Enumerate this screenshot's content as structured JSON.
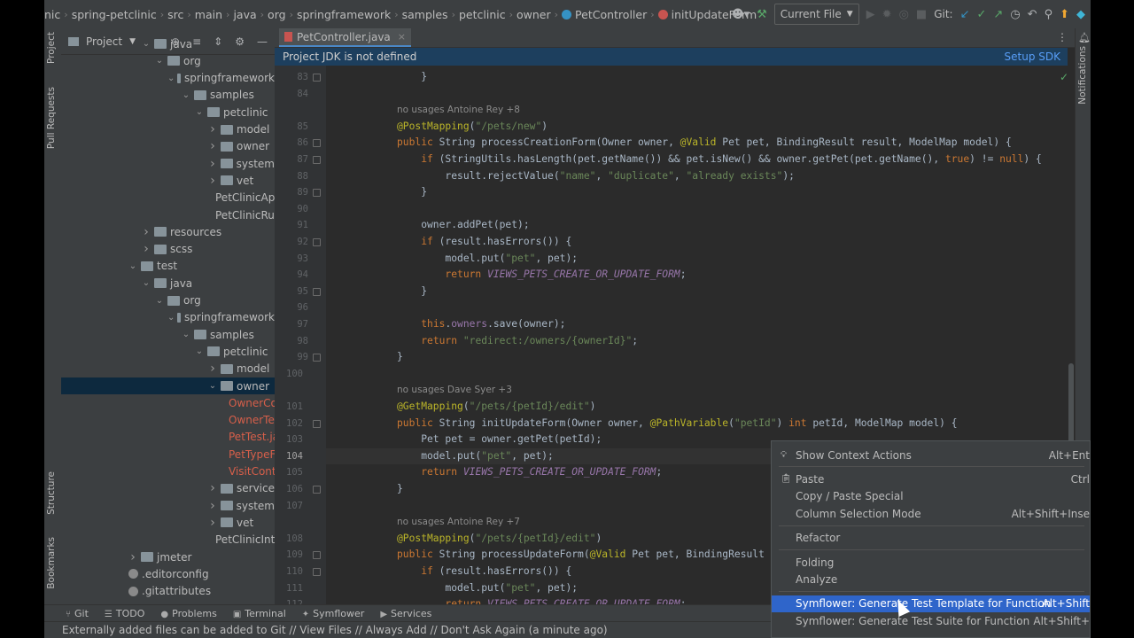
{
  "navbar": {
    "crumbs": [
      "nic",
      "spring-petclinic",
      "src",
      "main",
      "java",
      "org",
      "springframework",
      "samples",
      "petclinic",
      "owner"
    ],
    "class_crumb": "PetController",
    "method_crumb": "initUpdateForm",
    "run_config": "Current File",
    "git_label": "Git:"
  },
  "left_strip": {
    "project": "Project",
    "pull_requests": "Pull Requests",
    "structure": "Structure",
    "bookmarks": "Bookmarks"
  },
  "right_strip": {
    "notifications": "Notifications"
  },
  "project": {
    "header": "Project",
    "rows": [
      {
        "label": "java",
        "indent": 0,
        "kind": "folder",
        "arrow": "down"
      },
      {
        "label": "org",
        "indent": 1,
        "kind": "folder",
        "arrow": "down"
      },
      {
        "label": "springframework",
        "indent": 2,
        "kind": "folder",
        "arrow": "down"
      },
      {
        "label": "samples",
        "indent": 3,
        "kind": "folder",
        "arrow": "down"
      },
      {
        "label": "petclinic",
        "indent": 4,
        "kind": "folder",
        "arrow": "down"
      },
      {
        "label": "model",
        "indent": 5,
        "kind": "folder",
        "arrow": "right"
      },
      {
        "label": "owner",
        "indent": 5,
        "kind": "folder",
        "arrow": "right"
      },
      {
        "label": "system",
        "indent": 5,
        "kind": "folder",
        "arrow": "right"
      },
      {
        "label": "vet",
        "indent": 5,
        "kind": "folder",
        "arrow": "right"
      },
      {
        "label": "PetClinicAppli",
        "indent": 5,
        "kind": "java",
        "arrow": ""
      },
      {
        "label": "PetClinicRunti",
        "indent": 5,
        "kind": "java",
        "arrow": ""
      },
      {
        "label": "resources",
        "indent": 0,
        "kind": "folder",
        "arrow": "right"
      },
      {
        "label": "scss",
        "indent": 0,
        "kind": "folder",
        "arrow": "right"
      },
      {
        "label": "test",
        "indent": -1,
        "kind": "folder",
        "arrow": "down"
      },
      {
        "label": "java",
        "indent": 0,
        "kind": "folder",
        "arrow": "down"
      },
      {
        "label": "org",
        "indent": 1,
        "kind": "folder",
        "arrow": "down"
      },
      {
        "label": "springframework",
        "indent": 2,
        "kind": "folder",
        "arrow": "down"
      },
      {
        "label": "samples",
        "indent": 3,
        "kind": "folder",
        "arrow": "down"
      },
      {
        "label": "petclinic",
        "indent": 4,
        "kind": "folder",
        "arrow": "down"
      },
      {
        "label": "model",
        "indent": 5,
        "kind": "folder",
        "arrow": "right"
      },
      {
        "label": "owner",
        "indent": 5,
        "kind": "folder",
        "arrow": "down",
        "selected": true
      },
      {
        "label": "OwnerCon",
        "indent": 6,
        "kind": "java-red",
        "arrow": ""
      },
      {
        "label": "OwnerTest",
        "indent": 6,
        "kind": "java-red",
        "arrow": ""
      },
      {
        "label": "PetTest.jav",
        "indent": 6,
        "kind": "java-red",
        "arrow": ""
      },
      {
        "label": "PetTypeFo",
        "indent": 6,
        "kind": "java-red",
        "arrow": ""
      },
      {
        "label": "VisitContro",
        "indent": 6,
        "kind": "java-red",
        "arrow": ""
      },
      {
        "label": "service",
        "indent": 5,
        "kind": "folder",
        "arrow": "right"
      },
      {
        "label": "system",
        "indent": 5,
        "kind": "folder",
        "arrow": "right"
      },
      {
        "label": "vet",
        "indent": 5,
        "kind": "folder",
        "arrow": "right"
      },
      {
        "label": "PetClinicInteg",
        "indent": 5,
        "kind": "java",
        "arrow": ""
      },
      {
        "label": "jmeter",
        "indent": -1,
        "kind": "folder",
        "arrow": "right"
      },
      {
        "label": ".editorconfig",
        "indent": -2,
        "kind": "cfg",
        "arrow": ""
      },
      {
        "label": ".gitattributes",
        "indent": -2,
        "kind": "cfg",
        "arrow": ""
      }
    ]
  },
  "editor": {
    "tab_label": "PetController.java",
    "banner_text": "Project JDK is not defined",
    "banner_action": "Setup SDK",
    "current_line": "104",
    "lines": [
      {
        "ln": "83",
        "fold": true,
        "code": "    }"
      },
      {
        "ln": "84",
        "code": ""
      },
      {
        "ln": "",
        "inlay": true,
        "code": "no usages   Antoine Rey +8"
      },
      {
        "ln": "85",
        "code": "@PostMapping(\"/pets/new\")"
      },
      {
        "ln": "86",
        "fold": true,
        "code": "public String processCreationForm(Owner owner, @Valid Pet pet, BindingResult result, ModelMap model) {"
      },
      {
        "ln": "87",
        "fold": true,
        "code": "    if (StringUtils.hasLength(pet.getName()) && pet.isNew() && owner.getPet(pet.getName(), true) != null) {"
      },
      {
        "ln": "88",
        "code": "        result.rejectValue(\"name\", \"duplicate\", \"already exists\");"
      },
      {
        "ln": "89",
        "fold": true,
        "code": "    }"
      },
      {
        "ln": "90",
        "code": ""
      },
      {
        "ln": "91",
        "code": "    owner.addPet(pet);"
      },
      {
        "ln": "92",
        "fold": true,
        "code": "    if (result.hasErrors()) {"
      },
      {
        "ln": "93",
        "code": "        model.put(\"pet\", pet);"
      },
      {
        "ln": "94",
        "code": "        return VIEWS_PETS_CREATE_OR_UPDATE_FORM;"
      },
      {
        "ln": "95",
        "fold": true,
        "code": "    }"
      },
      {
        "ln": "96",
        "code": ""
      },
      {
        "ln": "97",
        "code": "    this.owners.save(owner);"
      },
      {
        "ln": "98",
        "code": "    return \"redirect:/owners/{ownerId}\";"
      },
      {
        "ln": "99",
        "fold": true,
        "code": "}"
      },
      {
        "ln": "100",
        "code": ""
      },
      {
        "ln": "",
        "inlay": true,
        "code": "no usages   Dave Syer +3"
      },
      {
        "ln": "101",
        "code": "@GetMapping(\"/pets/{petId}/edit\")"
      },
      {
        "ln": "102",
        "fold": true,
        "code": "public String initUpdateForm(Owner owner, @PathVariable(\"petId\") int petId, ModelMap model) {"
      },
      {
        "ln": "103",
        "code": "    Pet pet = owner.getPet(petId);"
      },
      {
        "ln": "104",
        "code": "    model.put(\"pet\", pet);"
      },
      {
        "ln": "105",
        "code": "    return VIEWS_PETS_CREATE_OR_UPDATE_FORM;"
      },
      {
        "ln": "106",
        "fold": true,
        "code": "}"
      },
      {
        "ln": "107",
        "code": ""
      },
      {
        "ln": "",
        "inlay": true,
        "code": "no usages   Antoine Rey +7"
      },
      {
        "ln": "108",
        "code": "@PostMapping(\"/pets/{petId}/edit\")"
      },
      {
        "ln": "109",
        "fold": true,
        "code": "public String processUpdateForm(@Valid Pet pet, BindingResult result, "
      },
      {
        "ln": "110",
        "fold": true,
        "code": "    if (result.hasErrors()) {"
      },
      {
        "ln": "111",
        "code": "        model.put(\"pet\", pet);"
      },
      {
        "ln": "112",
        "code": "        return VIEWS_PETS_CREATE_OR_UPDATE_FORM;"
      }
    ]
  },
  "tool_windows": [
    "Git",
    "TODO",
    "Problems",
    "Terminal",
    "Symflower",
    "Services"
  ],
  "status_text": "Externally added files can be added to Git // View Files // Always Add // Don't Ask Again (a minute ago)",
  "context_menu": {
    "items": [
      {
        "label": "Show Context Actions",
        "shortcut": "Alt+Ent",
        "icon": "bulb"
      },
      {
        "sep": true
      },
      {
        "label": "Paste",
        "shortcut": "Ctrl",
        "icon": "clipboard"
      },
      {
        "label": "Copy / Paste Special",
        "shortcut": ""
      },
      {
        "label": "Column Selection Mode",
        "shortcut": "Alt+Shift+Inse"
      },
      {
        "sep": true
      },
      {
        "label": "Refactor",
        "shortcut": ""
      },
      {
        "sep": true
      },
      {
        "label": "Folding",
        "shortcut": ""
      },
      {
        "label": "Analyze",
        "shortcut": ""
      },
      {
        "sep": true
      },
      {
        "label": "Symflower: Generate Test Template for Function",
        "shortcut": "Alt+Shift",
        "highlight": true
      },
      {
        "label": "Symflower: Generate Test Suite for Function",
        "shortcut": "Alt+Shift+"
      }
    ]
  },
  "colors": {
    "accent": "#2f65ca",
    "selection": "#0d293e",
    "banner": "#1d3f5e",
    "keyword": "#cc7832",
    "string": "#6a8759",
    "annotation": "#bbb529"
  }
}
